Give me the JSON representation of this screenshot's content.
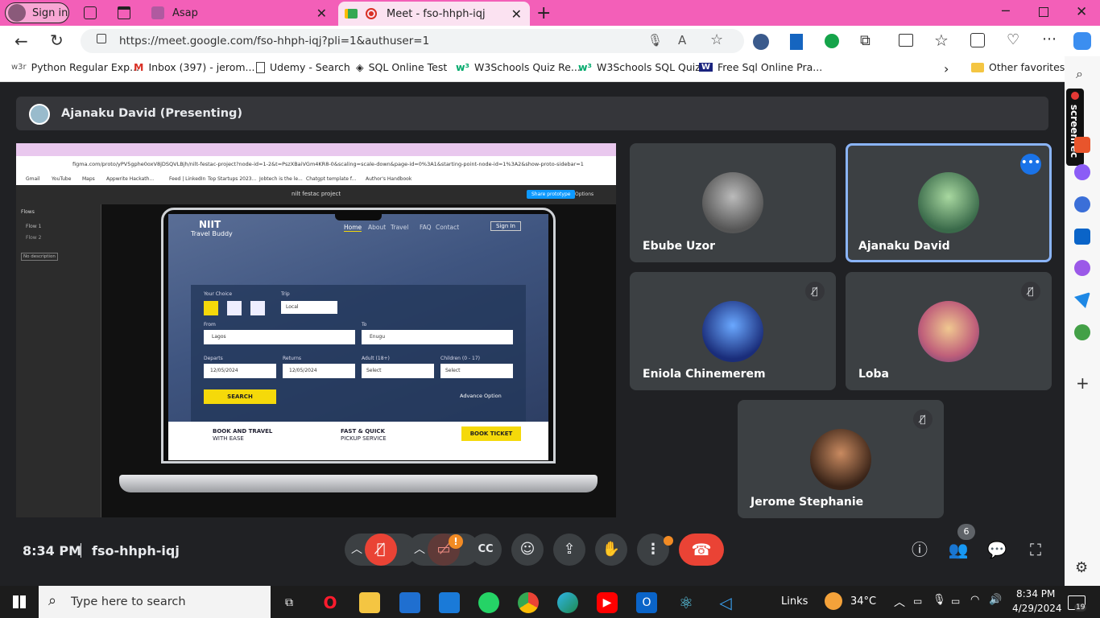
{
  "browser": {
    "profile_label": "Sign in",
    "tabs": [
      {
        "label": "Asap"
      },
      {
        "label": "Meet - fso-hhph-iqj"
      }
    ],
    "url": "https://meet.google.com/fso-hhph-iqj?pli=1&authuser=1",
    "favorites": [
      "Python Regular Exp...",
      "Inbox (397) - jerom...",
      "Udemy - Search",
      "SQL Online Test",
      "W3Schools Quiz Re...",
      "W3Schools SQL Quiz",
      "Free Sql Online Pra..."
    ],
    "other_favorites": "Other favorites"
  },
  "meet": {
    "presenter_label": "Ajanaku David (Presenting)",
    "participants": [
      {
        "name": "Ebube Uzor",
        "muted": false
      },
      {
        "name": "Ajanaku David",
        "muted": false
      },
      {
        "name": "Eniola Chinemerem",
        "muted": true
      },
      {
        "name": "Loba",
        "muted": true
      },
      {
        "name": "Jerome Stephanie",
        "muted": true
      }
    ],
    "time": "8:34 PM",
    "meeting_code": "fso-hhph-iqj",
    "people_count": "6",
    "camera_alert": "!",
    "screenrec_label": "screenrec"
  },
  "shared_screen": {
    "figma_url": "figma.com/proto/yPV5gphe0oxV8jDSQVLBjh/nilt-festac-project?node-id=1-2&t=PszXBaiVGm4KR8-0&scaling=scale-down&page-id=0%3A1&starting-point-node-id=1%3A2&show-proto-sidebar=1",
    "bookmarks": [
      "Gmail",
      "YouTube",
      "Maps",
      "Appwrite Hackath...",
      "Feed | LinkedIn",
      "Top Startups 2023...",
      "Jobtech is the le...",
      "Chatgpt template f...",
      "Author's Handbook"
    ],
    "project_title": "nilt festac project",
    "share_label": "Share prototype",
    "options_label": "Options",
    "flows_title": "Flows",
    "flows": [
      "Flow 1",
      "Flow 2"
    ],
    "no_description": "No description",
    "site": {
      "brand": "NIIT",
      "brand_sub": "Travel Buddy",
      "nav": [
        "Home",
        "About",
        "Travel",
        "FAQ",
        "Contact"
      ],
      "sign_in": "Sign In",
      "your_choice": "Your Choice",
      "trip_label": "Trip",
      "trip_value": "Local",
      "from_label": "From",
      "from_value": "Lagos",
      "to_label": "To",
      "to_value": "Enugu",
      "departs_label": "Departs",
      "departs_value": "12/05/2024",
      "returns_label": "Returns",
      "returns_value": "12/05/2024",
      "adult_label": "Adult (18+)",
      "adult_value": "Select",
      "children_label": "Children (0 - 17)",
      "children_value": "Select",
      "search": "SEARCH",
      "advance": "Advance Option",
      "book_travel_1": "BOOK AND TRAVEL",
      "book_travel_2": "WITH EASE",
      "fast_1": "FAST & QUICK",
      "fast_2": "PICKUP SERVICE",
      "book_ticket": "BOOK TICKET"
    }
  },
  "taskbar": {
    "search_placeholder": "Type here to search",
    "links": "Links",
    "temperature": "34°C",
    "time": "8:34 PM",
    "date": "4/29/2024",
    "notifications": "19"
  },
  "colors": {
    "tab_bar": "#f35fb8",
    "meet_bg": "#202124",
    "tile_bg": "#3c4043",
    "end_call": "#ea4335",
    "mic_off": "#ea4335",
    "site_yellow": "#f5d90a",
    "active_tile_border": "#8ab4f8"
  }
}
